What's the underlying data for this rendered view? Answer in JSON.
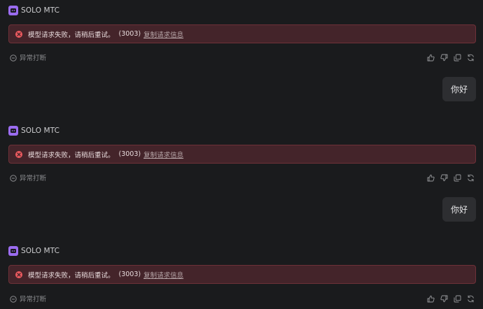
{
  "bot": {
    "name": "SOLO MTC"
  },
  "error": {
    "message": "模型请求失败，请稍后重试。",
    "code": "(3003)",
    "link": "复制请求信息"
  },
  "status": {
    "interrupted": "异常打断"
  },
  "user": {
    "message": "你好"
  },
  "icons": {
    "bot_avatar": "robot-icon",
    "error": "x-circle-icon",
    "interrupted": "minus-circle-icon",
    "like": "thumbs-up-icon",
    "dislike": "thumbs-down-icon",
    "copy": "copy-icon",
    "retry": "refresh-icon"
  },
  "colors": {
    "accent": "#9b6cf0",
    "error_bg": "#44242a",
    "error_border": "#6e3138",
    "error_icon": "#ec5a5f"
  }
}
